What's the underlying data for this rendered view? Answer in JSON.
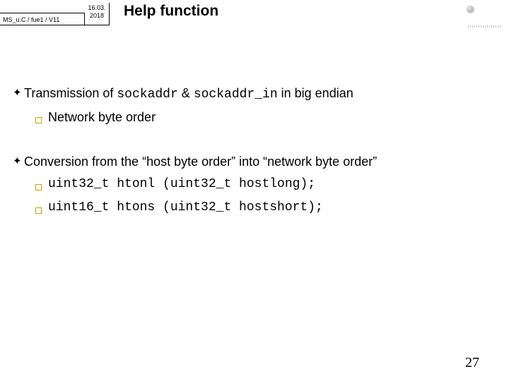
{
  "header": {
    "course": "MS_u.C / fue1 / V11",
    "date_top": "16.03.",
    "date_bottom": "2018"
  },
  "title": "Help function",
  "bullets": {
    "b1_pre": "Transmission of ",
    "b1_code1": "sockaddr",
    "b1_mid": " & ",
    "b1_code2": "sockaddr_in",
    "b1_post": " in big endian",
    "b1_sub1": "Network byte order",
    "b2": "Conversion from the “host byte order” into “network byte order”",
    "b2_sub1": "uint32_t htonl (uint32_t hostlong);",
    "b2_sub2": "uint16_t htons (uint32_t hostshort);"
  },
  "page": "27"
}
